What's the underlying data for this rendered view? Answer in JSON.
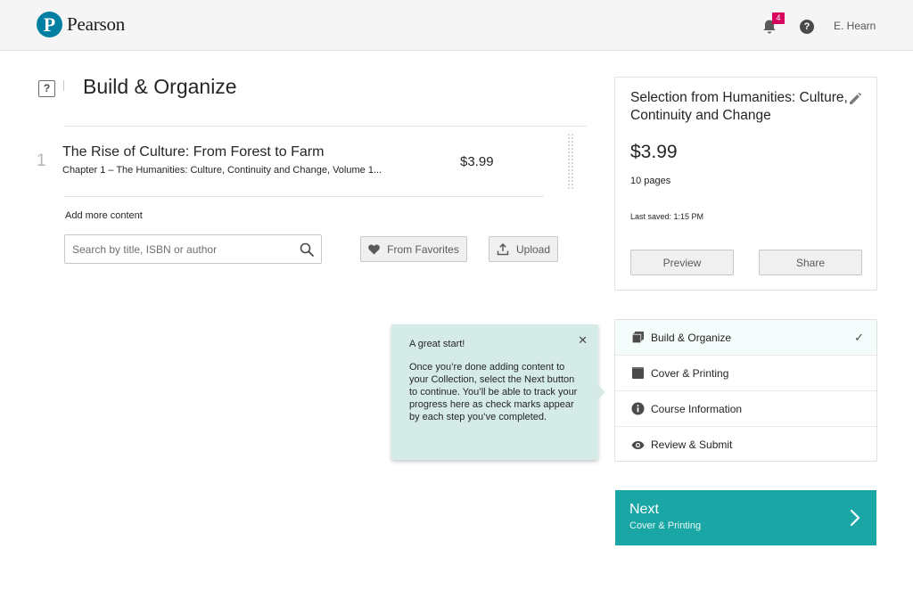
{
  "header": {
    "logo_letter": "P",
    "logo_text": "Pearson",
    "notification_count": "4",
    "help_glyph": "?",
    "user_name": "E. Hearn",
    "brand_color": "#007fa3",
    "badge_color": "#d6005d"
  },
  "main": {
    "help_glyph": "?",
    "title": "Build & Organize",
    "items": [
      {
        "index": "1",
        "title": "The Rise of Culture: From Forest to Farm",
        "subtitle": "Chapter 1 – The Humanities: Culture, Continuity and Change, Volume 1...",
        "price": "$3.99"
      }
    ],
    "add_label": "Add more content",
    "search": {
      "placeholder": "Search by title, ISBN or author",
      "value": ""
    },
    "favorites_label": "From Favorites",
    "upload_label": "Upload"
  },
  "summary": {
    "title": "Selection from Humanities: Culture, Continuity and Change",
    "price": "$3.99",
    "pages": "10 pages",
    "saved": "Last saved: 1:15 PM",
    "preview_label": "Preview",
    "share_label": "Share"
  },
  "steps": [
    {
      "label": "Build & Organize",
      "icon": "stack-icon",
      "check": "✓"
    },
    {
      "label": "Cover & Printing",
      "icon": "book-icon"
    },
    {
      "label": "Course Information",
      "icon": "info-icon"
    },
    {
      "label": "Review & Submit",
      "icon": "eye-icon"
    }
  ],
  "tooltip": {
    "title": "A great start!",
    "close": "✕",
    "body": "Once you’re done adding content to your Collection, select the Next button to continue. You’ll be able to track your progress here as check marks appear by each step you’ve completed."
  },
  "next": {
    "label": "Next",
    "sub": "Cover & Printing",
    "color": "#19a6a4"
  }
}
